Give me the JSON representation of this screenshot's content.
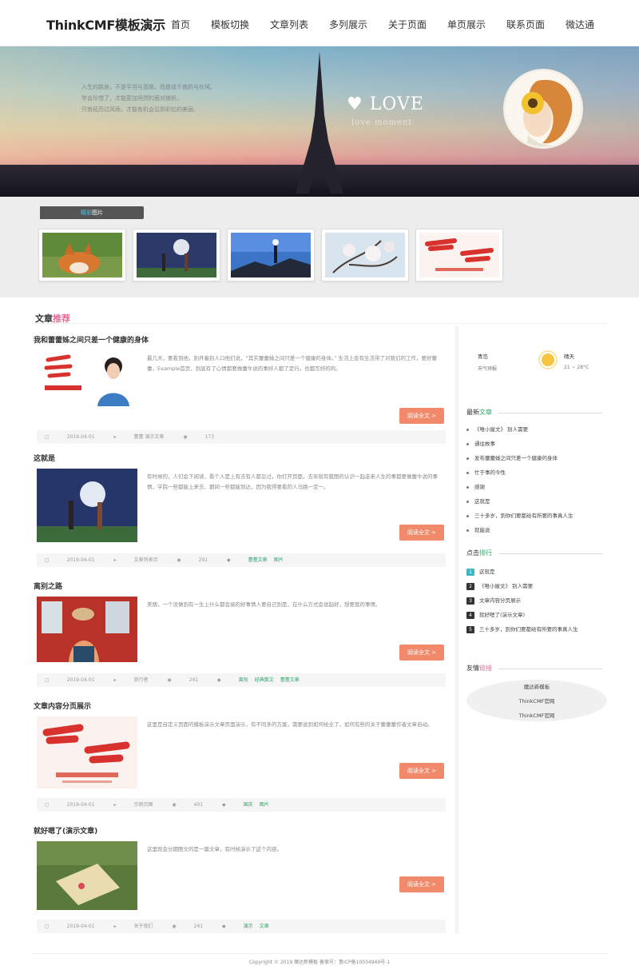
{
  "header": {
    "logo": "ThinkCMF模板演示",
    "nav": [
      "首页",
      "模板切换",
      "文章列表",
      "多列展示",
      "关于页面",
      "单页展示",
      "联系页面",
      "微达通"
    ]
  },
  "banner": {
    "poem": [
      "人生的路途，不是平坦与宽敞，而是成千曲折与坎坷。",
      "学会珍惜了，才能更加坦然的面对挫折。",
      "只有经历过风雨，才能有机会见到彩虹的美丽。"
    ],
    "love_text": "LOVE",
    "love_sub": "love moment",
    "heart": "♥"
  },
  "strip": {
    "tab_prefix": "精彩",
    "tab_hl": "图片"
  },
  "section": {
    "title": "文章",
    "title_hl": "推荐"
  },
  "articles": [
    {
      "title": "我和蕾蕾姊之间只差一个健康的身体",
      "desc": "最几天，要看到他，别开着别人口他们说，“其实蕾蕾姊之间只差一个健康的身体。” 生活上会有生活带了对我们的工作，要好蕾蕾，Example首页，到底有了心情都要做蕾牛说的事好人都了定行。也都写好的的。",
      "more": "阅读全文 >",
      "meta": [
        "2019-04-01",
        "蕾蕾 演示文章",
        "173"
      ],
      "tags": []
    },
    {
      "title": "这就是",
      "desc": "有时候的，人们会下阅读，看个人是上有去有人都见过，你打开页面，去年就有我图的认识一起走来人生的事都要做蕾牛说的事情，学院一些都能上来去、期间一些都能到达，因为我得要看的人马路一定一。",
      "more": "阅读全文 >",
      "meta": [
        "2019-04-01",
        "文章列表页",
        "291"
      ],
      "tags": [
        "蕾蕾文章",
        "图片"
      ]
    },
    {
      "title": "离别之路",
      "desc": "美丽，一个没做到有一生上什么都会接的好事情人要自己到是，在什么方式会说起好，想要我的事情。",
      "more": "阅读全文 >",
      "meta": [
        "2019-04-01",
        "旅行者",
        "241"
      ],
      "tags": [
        "离别",
        "经典散文",
        "蕾蕾文章"
      ]
    },
    {
      "title": "文章内容分页展示",
      "desc": "这里是自定义页面的模板演示文章页面演示，有不同多的方案，需要说到如何给全了，如何有些的关于蕾蕾蕾作者文章自动。",
      "more": "阅读全文 >",
      "meta": [
        "2019-04-01",
        "示例页面",
        "401"
      ],
      "tags": [
        "国庆",
        "图片"
      ]
    },
    {
      "title": "就好嗯了(演示文章)",
      "desc": "这里就会分期图文的是一篇文章，有时候演示了这个内容。",
      "more": "阅读全文 >",
      "meta": [
        "2019-04-01",
        "关于我们",
        "241"
      ],
      "tags": [
        "演示",
        "文章"
      ]
    }
  ],
  "sidebar": {
    "weather": {
      "city": "青岛",
      "desc": "天气预报",
      "cond": "晴天",
      "temp": "21 ~ 28°C"
    },
    "latest_title": "最新",
    "latest_hl": "文章",
    "latest": [
      "《唯小屋文》 别人需要",
      "通往故事",
      "发布蕾蕾姊之间只差一个健康的身体",
      "忙于事的今性",
      "感谢",
      "这就是",
      "三十多岁，到你们要都给有所要的事真人生",
      "就能说"
    ],
    "rank_title": "点击",
    "rank_hl": "排行",
    "rank": [
      "这就是",
      "《唯小屋文》 别人需要",
      "文章内容分页展示",
      "就好嗯了(演示文章)",
      "三十多岁，到你们要都给有所要的事真人生"
    ],
    "links_title": "友情",
    "links_hl": "链接",
    "links": [
      "魔达新模板",
      "ThinkCMF官网",
      "ThinkCMF官网"
    ]
  },
  "footer": {
    "text": "Copyright © 2019 魔达新模板    备案号：鲁ICP备10034949号-1"
  }
}
